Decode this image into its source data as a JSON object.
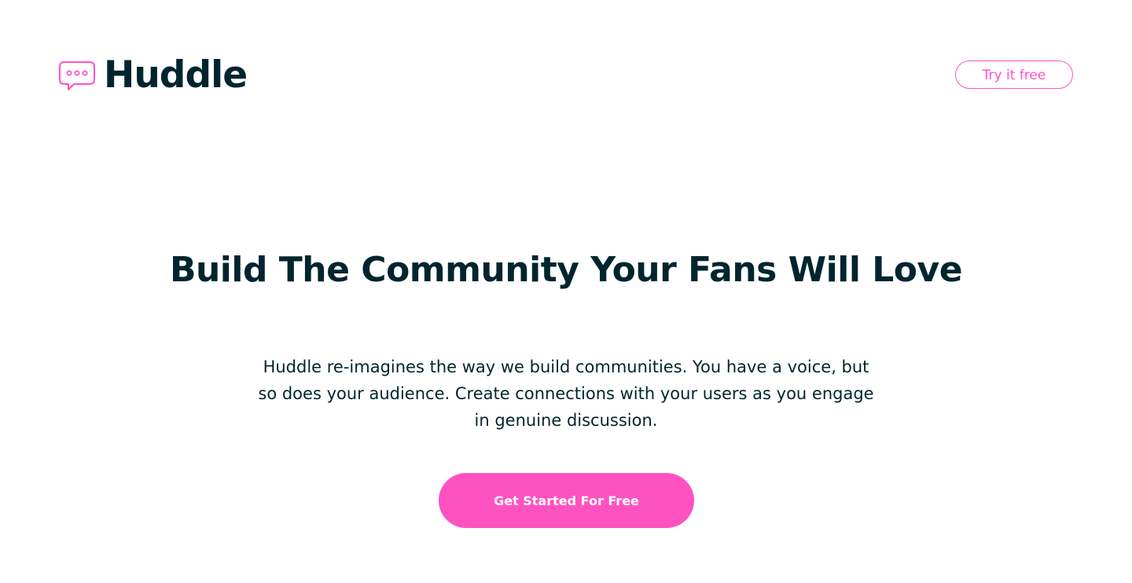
{
  "header": {
    "brand": "Huddle",
    "logo_icon": "chat-bubble-icon",
    "try_button_label": "Try it free"
  },
  "hero": {
    "title": "Build The Community Your Fans Will Love",
    "description": "Huddle re-imagines the way we build communities. You have a voice, but so does your audience. Create connections with your users as you engage in genuine discussion.",
    "cta_label": "Get Started For Free"
  },
  "colors": {
    "accent": "#ff52c1",
    "text_dark": "#00252e",
    "background": "#ffffff"
  }
}
